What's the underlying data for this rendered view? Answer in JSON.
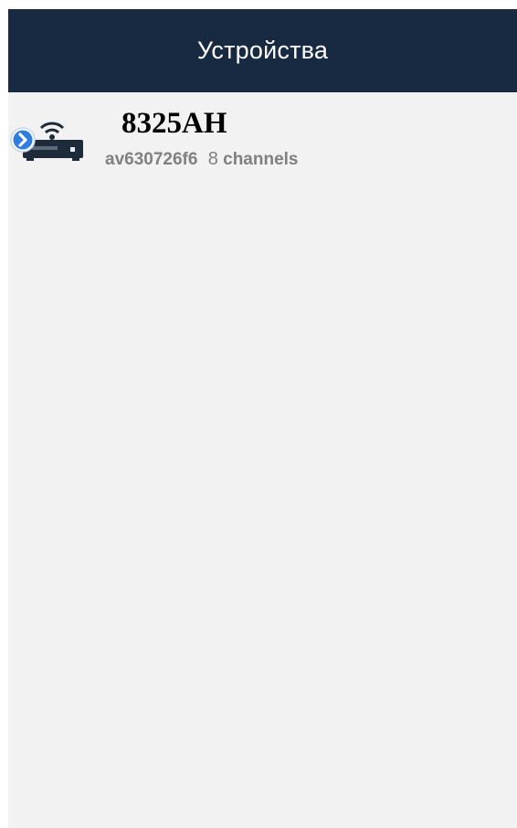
{
  "header": {
    "title": "Устройства"
  },
  "devices": [
    {
      "name": "8325AH",
      "id": "av630726f6",
      "channel_count": "8",
      "channels_label": "channels",
      "icon": "wifi-dvr-icon",
      "expand_icon": "chevron-right-circle-icon"
    }
  ],
  "colors": {
    "header_bg": "#172a41",
    "content_bg": "#f2f2f2",
    "accent_blue": "#2f7de1",
    "icon_dark": "#1e2b3b",
    "subtext": "#808080"
  }
}
